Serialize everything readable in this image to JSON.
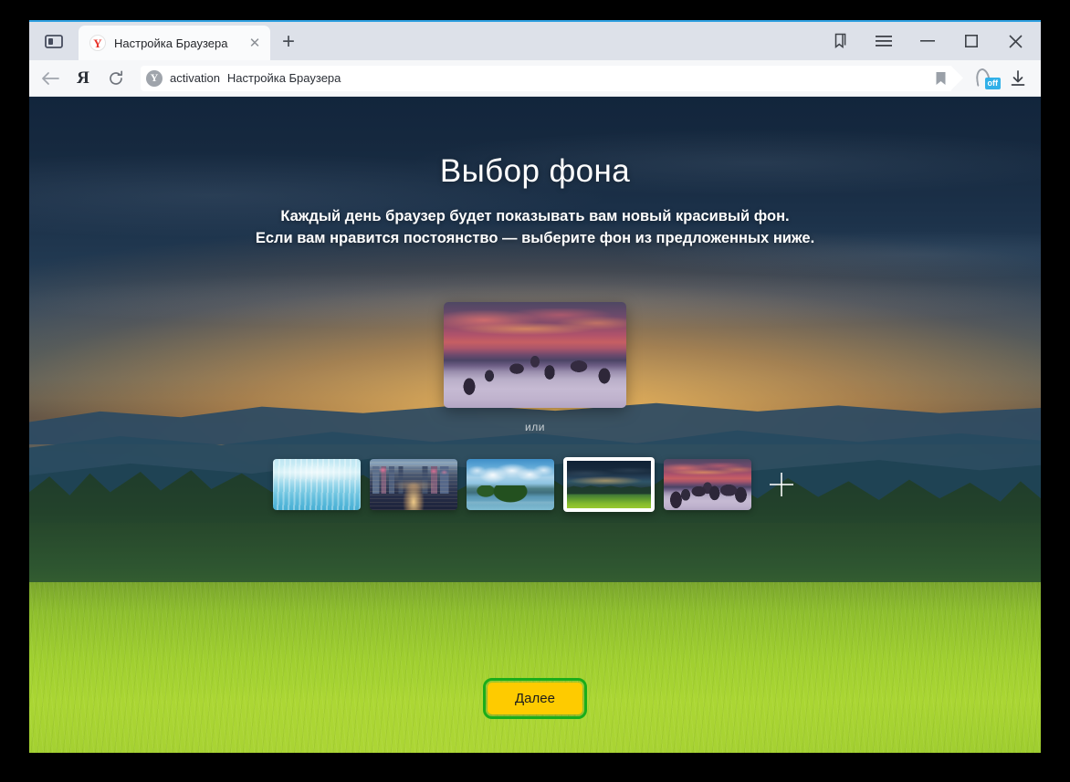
{
  "window": {
    "tab_strip": {
      "panel_toggle_icon": "sidebar-panel-icon",
      "new_tab_label": "+",
      "tabs": [
        {
          "favicon_icon": "yandex-favicon",
          "favicon_glyph": "Y",
          "title": "Настройка Браузера",
          "close_icon": "close-icon",
          "close_glyph": "✕",
          "active": true
        }
      ],
      "window_controls": {
        "bookmarks_icon": "bookmarks-icon",
        "menu_icon": "hamburger-menu-icon",
        "minimize_icon": "minimize-icon",
        "maximize_icon": "maximize-icon",
        "close_icon": "window-close-icon"
      }
    },
    "toolbar": {
      "back_icon": "back-arrow-icon",
      "yandex_icon": "yandex-logo-icon",
      "yandex_glyph": "Я",
      "reload_icon": "reload-icon",
      "omnibox": {
        "shield_icon": "yandex-shield-icon",
        "shield_glyph": "Y",
        "scheme_label": "activation",
        "page_title": "Настройка Браузера",
        "bookmark_icon": "bookmark-star-icon"
      },
      "turbo": {
        "icon": "turbo-mode-icon",
        "badge_label": "off",
        "badge_color": "#31b0e8"
      },
      "downloads_icon": "downloads-icon"
    }
  },
  "page": {
    "headline": "Выбор фона",
    "subtitle_line_1": "Каждый день браузер будет показывать вам новый красивый фон.",
    "subtitle_line_2": "Если вам нравится постоянство — выберите фон из предложенных ниже.",
    "preview": {
      "name": "background-preview",
      "description": "purple sunset over fog and rock spires"
    },
    "or_label": "или",
    "thumbnails": [
      {
        "name": "thumb-sea",
        "description": "pale blue sunlit sea",
        "selected": false
      },
      {
        "name": "thumb-city",
        "description": "city avenue at dusk with pink-lit towers",
        "selected": false
      },
      {
        "name": "thumb-lake",
        "description": "lake island with church tower and clouds",
        "selected": false
      },
      {
        "name": "thumb-storm",
        "description": "stormy dark ridge above a green meadow",
        "selected": true
      },
      {
        "name": "thumb-sunsetfog",
        "description": "purple sunset over fog and rock spires",
        "selected": false
      }
    ],
    "add_background": {
      "icon": "plus-icon",
      "label": "+"
    },
    "next_button": {
      "label": "Далее",
      "background_color": "#fecb00",
      "focus_ring_color": "#1aad1a"
    },
    "wallpaper": {
      "description": "stormy dark blue sky over layered mountain ridges, dark conifer forest and a bright green flowering meadow",
      "sky_color": "#12253c",
      "glow_color": "#ffc460",
      "meadow_color": "#a0cf30"
    }
  }
}
